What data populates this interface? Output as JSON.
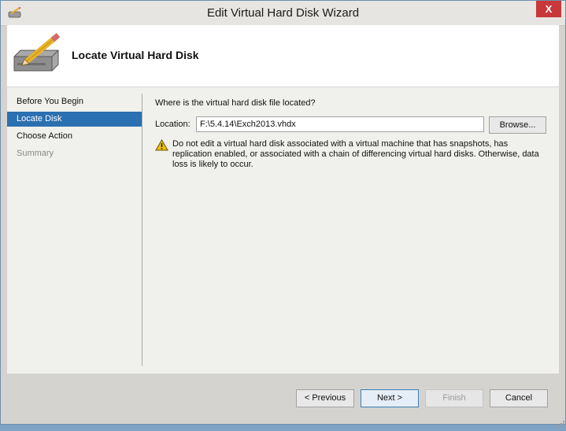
{
  "window": {
    "title": "Edit Virtual Hard Disk Wizard",
    "close_glyph": "X"
  },
  "header": {
    "title": "Locate Virtual Hard Disk"
  },
  "nav": {
    "items": [
      {
        "label": "Before You Begin",
        "state": "normal"
      },
      {
        "label": "Locate Disk",
        "state": "selected"
      },
      {
        "label": "Choose Action",
        "state": "normal"
      },
      {
        "label": "Summary",
        "state": "disabled"
      }
    ]
  },
  "main": {
    "question": "Where is the virtual hard disk file located?",
    "location_label": "Location:",
    "location_value": "F:\\5.4.14\\Exch2013.vhdx",
    "browse_label": "Browse...",
    "warning": "Do not edit a virtual hard disk associated with a virtual machine that has snapshots, has replication enabled, or associated with a chain of differencing virtual hard disks. Otherwise, data loss is likely to occur."
  },
  "footer": {
    "previous_label": "< Previous",
    "next_label": "Next >",
    "finish_label": "Finish",
    "cancel_label": "Cancel"
  },
  "colors": {
    "selection": "#2b70b0",
    "close": "#c8383a",
    "warning": "#f2c200"
  }
}
